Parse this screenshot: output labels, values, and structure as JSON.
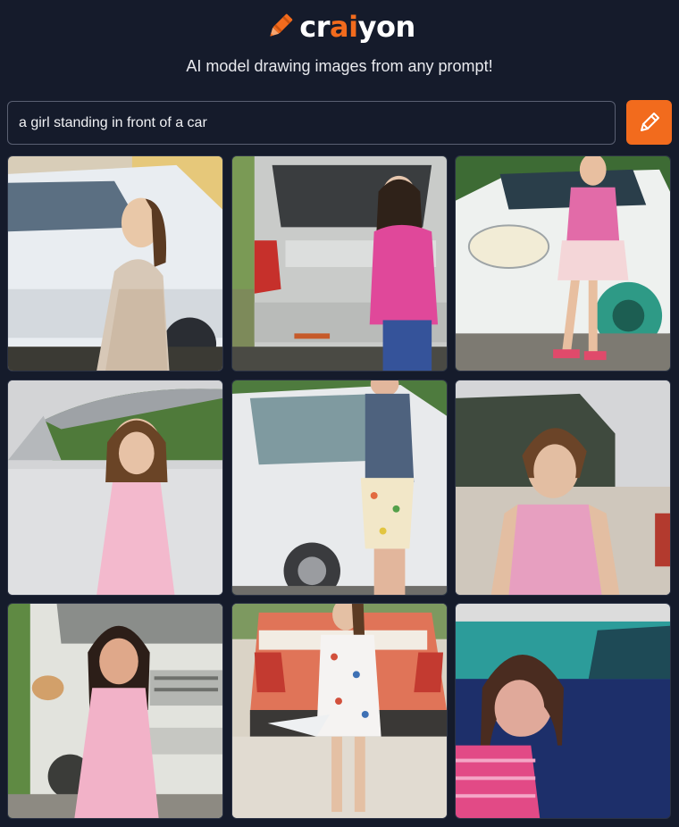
{
  "brand": {
    "pre": "cr",
    "ai": "ai",
    "post": "yon"
  },
  "tagline": "AI model drawing images from any prompt!",
  "prompt": {
    "value": "a girl standing in front of a car"
  },
  "draw_button": {
    "icon": "pencil-icon"
  },
  "colors": {
    "background": "#151b2b",
    "accent": "#f26b1d"
  },
  "images": [
    {
      "name": "generated-image-1"
    },
    {
      "name": "generated-image-2"
    },
    {
      "name": "generated-image-3"
    },
    {
      "name": "generated-image-4"
    },
    {
      "name": "generated-image-5"
    },
    {
      "name": "generated-image-6"
    },
    {
      "name": "generated-image-7"
    },
    {
      "name": "generated-image-8"
    },
    {
      "name": "generated-image-9"
    }
  ]
}
